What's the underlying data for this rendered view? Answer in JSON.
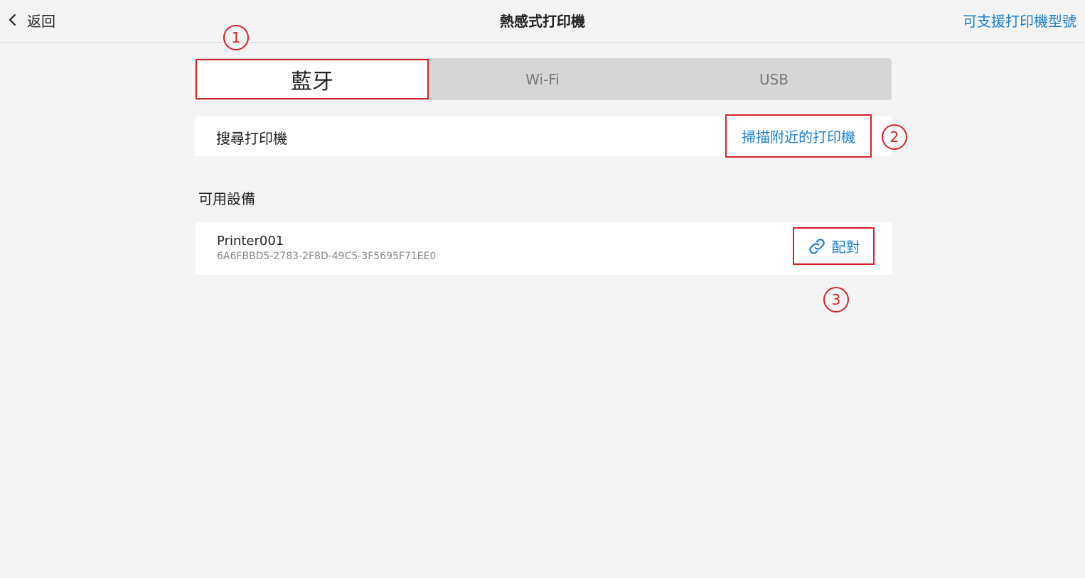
{
  "header": {
    "back_label": "返回",
    "title": "熱感式打印機",
    "models_link": "可支援打印機型號"
  },
  "tabs": [
    {
      "label": "藍牙",
      "active": true
    },
    {
      "label": "Wi-Fi",
      "active": false
    },
    {
      "label": "USB",
      "active": false
    }
  ],
  "search": {
    "label": "搜尋打印機",
    "scan_button": "掃描附近的打印機"
  },
  "devices_section": {
    "title": "可用設備",
    "devices": [
      {
        "name": "Printer001",
        "id": "6A6FBBD5-2783-2F8D-49C5-3F5695F71EE0",
        "pair_label": "配對",
        "pair_icon": "link-icon"
      }
    ]
  },
  "annotations": [
    "1",
    "2",
    "3"
  ],
  "colors": {
    "accent": "#1a7fcf",
    "highlight": "#d5232b",
    "background": "#f4f4f4"
  }
}
